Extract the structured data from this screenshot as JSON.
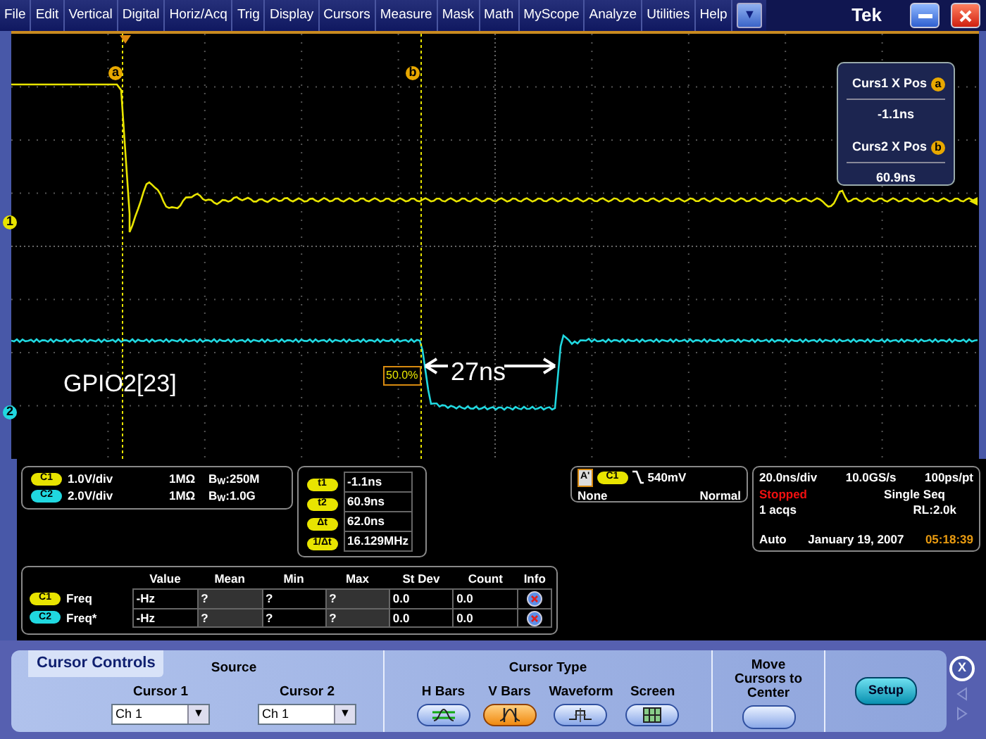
{
  "menu": {
    "items": [
      "File",
      "Edit",
      "Vertical",
      "Digital",
      "Horiz/Acq",
      "Trig",
      "Display",
      "Cursors",
      "Measure",
      "Mask",
      "Math",
      "MyScope",
      "Analyze",
      "Utilities",
      "Help"
    ],
    "dropdown": "▼",
    "title": "Tek"
  },
  "display": {
    "cursors": [
      {
        "label": "a"
      },
      {
        "label": "b"
      }
    ],
    "channel_markers": [
      {
        "label": "1",
        "color": "#e8e400"
      },
      {
        "label": "2",
        "color": "#20d8e0"
      }
    ],
    "signal_label": "GPIO2[23]",
    "delta_label": "27ns",
    "threshold_label": "50.0%",
    "readout": [
      {
        "label": "Curs1 X Pos",
        "badge": "a",
        "value": "-1.1ns"
      },
      {
        "label": "Curs2 X Pos",
        "badge": "b",
        "value": "60.9ns"
      }
    ]
  },
  "channels": [
    {
      "badge": "C1",
      "color": "#e8e400",
      "scale": "1.0V/div",
      "impedance": "1MΩ",
      "bandwidth": "B$_{W}$:250M"
    },
    {
      "badge": "C2",
      "color": "#20d8e0",
      "scale": "2.0V/div",
      "impedance": "1MΩ",
      "bandwidth": "B$_{W}$:1.0G"
    }
  ],
  "cursor_readout": [
    {
      "label": "t1",
      "value": "-1.1ns"
    },
    {
      "label": "t2",
      "value": "60.9ns"
    },
    {
      "label": "Δt",
      "value": "62.0ns"
    },
    {
      "label": "1/Δt",
      "value": "16.129MHz"
    }
  ],
  "trigger": {
    "type_mark": "A'",
    "channel": "C1",
    "level": "540mV",
    "coupling": "None",
    "mode": "Normal"
  },
  "timing": {
    "scale": "20.0ns/div",
    "rate": "10.0GS/s",
    "resolution": "100ps/pt",
    "state": "Stopped",
    "sequence": "Single Seq",
    "acqs": "1 acqs",
    "record": "RL:2.0k",
    "mode": "Auto",
    "date": "January 19, 2007",
    "time": "05:18:39"
  },
  "measurements": {
    "columns": [
      "Value",
      "Mean",
      "Min",
      "Max",
      "St Dev",
      "Count",
      "Info"
    ],
    "rows": [
      {
        "channel": "C1",
        "color": "#e8e400",
        "name": "Freq",
        "cells": [
          "-Hz",
          "?",
          "?",
          "?",
          "0.0",
          "0.0"
        ]
      },
      {
        "channel": "C2",
        "color": "#20d8e0",
        "name": "Freq*",
        "cells": [
          "-Hz",
          "?",
          "?",
          "?",
          "0.0",
          "0.0"
        ]
      }
    ]
  },
  "cursor_controls": {
    "tab": "Cursor Controls",
    "source_title": "Source",
    "sources": [
      {
        "label": "Cursor 1",
        "value": "Ch 1",
        "caret": "▼"
      },
      {
        "label": "Cursor 2",
        "value": "Ch 1",
        "caret": "▼"
      }
    ],
    "type_title": "Cursor Type",
    "types": [
      {
        "label": "H Bars",
        "kind": "hbars",
        "selected": false
      },
      {
        "label": "V Bars",
        "kind": "vbars",
        "selected": true
      },
      {
        "label": "Waveform",
        "kind": "waveform",
        "selected": false
      },
      {
        "label": "Screen",
        "kind": "screen",
        "selected": false
      }
    ],
    "move_label": "Move Cursors to Center",
    "setup": "Setup",
    "close": "X"
  }
}
